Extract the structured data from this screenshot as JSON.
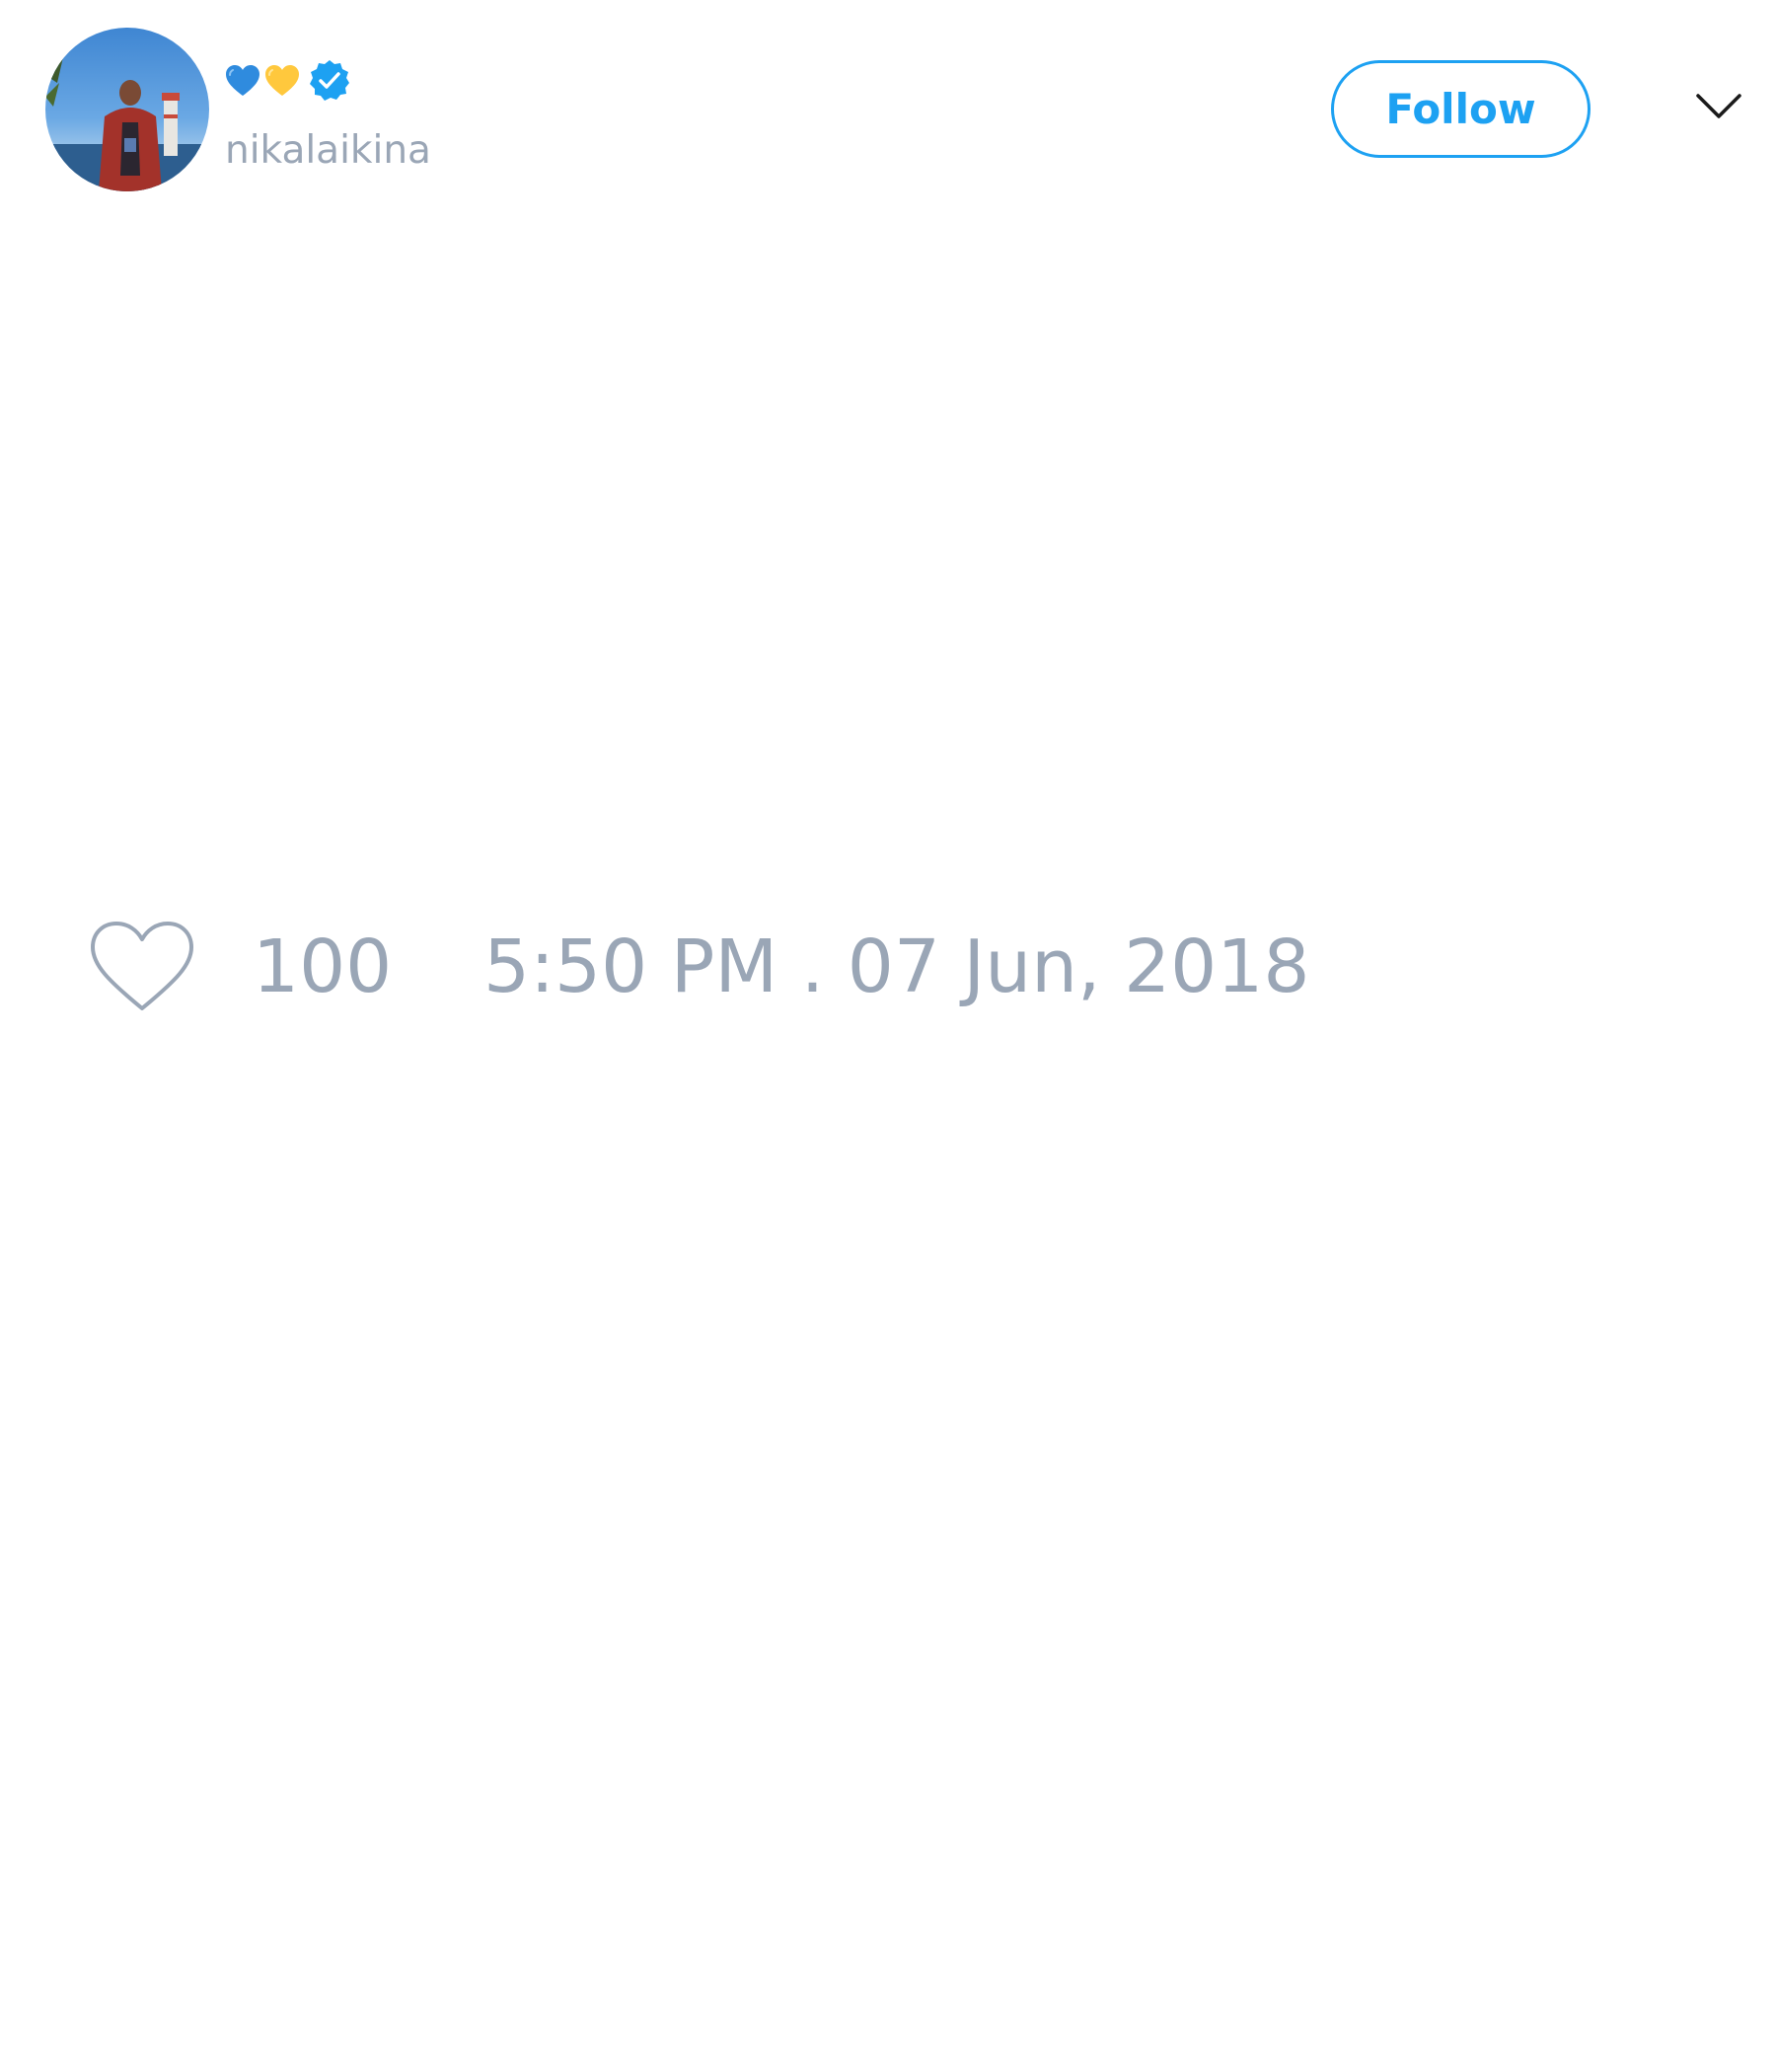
{
  "tweet": {
    "author": {
      "display_name_emoji": [
        "blue-heart",
        "yellow-heart"
      ],
      "verified": true,
      "handle": "nikalaikina"
    },
    "actions": {
      "follow_label": "Follow"
    },
    "stats": {
      "likes": "100"
    },
    "timestamp": "5:50 PM . 07 Jun, 2018"
  },
  "colors": {
    "accent": "#1da1f2",
    "muted_text": "#9aa6b6",
    "blue_heart": "#2f8bde",
    "yellow_heart": "#ffc83d",
    "background": "#ffffff"
  },
  "icons": {
    "like": "heart-outline-icon",
    "verified": "verified-badge-icon",
    "menu": "chevron-down-icon"
  }
}
